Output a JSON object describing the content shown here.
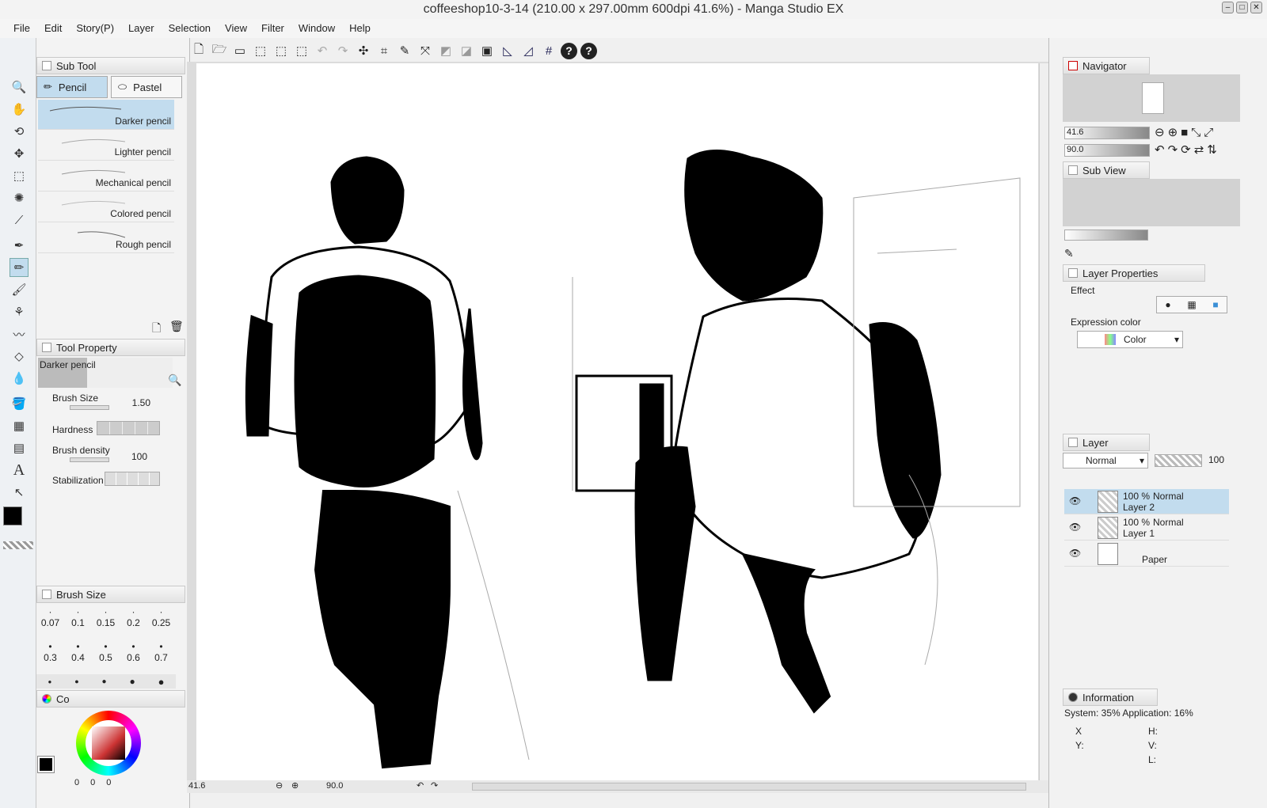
{
  "window": {
    "title": "coffeeshop10-3-14 (210.00 x 297.00mm 600dpi 41.6%)  - Manga Studio EX"
  },
  "menu": [
    "File",
    "Edit",
    "Story(P)",
    "Layer",
    "Selection",
    "View",
    "Filter",
    "Window",
    "Help"
  ],
  "subtool": {
    "title": "Sub Tool",
    "tabs": [
      "Pencil",
      "Pastel"
    ],
    "brushes": [
      "Darker pencil",
      "Lighter pencil",
      "Mechanical pencil",
      "Colored pencil",
      "Rough pencil"
    ]
  },
  "toolprop": {
    "title": "Tool Property",
    "preview": "Darker pencil",
    "brush_size_label": "Brush Size",
    "brush_size": "1.50",
    "hardness_label": "Hardness",
    "density_label": "Brush density",
    "density": "100",
    "stab_label": "Stabilization"
  },
  "brushsize": {
    "title": "Brush Size",
    "row1": [
      "0.07",
      "0.1",
      "0.15",
      "0.2",
      "0.25"
    ],
    "row2": [
      "0.3",
      "0.4",
      "0.5",
      "0.6",
      "0.7"
    ]
  },
  "colorpanel": {
    "title": "Co",
    "vals": [
      "0",
      "0",
      "0"
    ]
  },
  "navigator": {
    "title": "Navigator",
    "zoom": "41.6",
    "angle": "90.0"
  },
  "subview": {
    "title": "Sub View"
  },
  "layerprops": {
    "title": "Layer Properties",
    "effect": "Effect",
    "expr": "Expression color",
    "color": "Color"
  },
  "layerpanel": {
    "title": "Layer",
    "blend": "Normal",
    "opacity": "100",
    "layers": [
      {
        "pct": "100 %",
        "mode": "Normal",
        "name": "Layer 2"
      },
      {
        "pct": "100 %",
        "mode": "Normal",
        "name": "Layer 1"
      },
      {
        "pct": "",
        "mode": "",
        "name": "Paper"
      }
    ]
  },
  "info": {
    "title": "Information",
    "stats": "System: 35%  Application: 16%",
    "x": "X",
    "y": "Y:",
    "h": "H:",
    "v": "V:",
    "l": "L:"
  },
  "status": {
    "zoom": "41.6",
    "angle": "90.0"
  },
  "accent": "#c2dcee"
}
